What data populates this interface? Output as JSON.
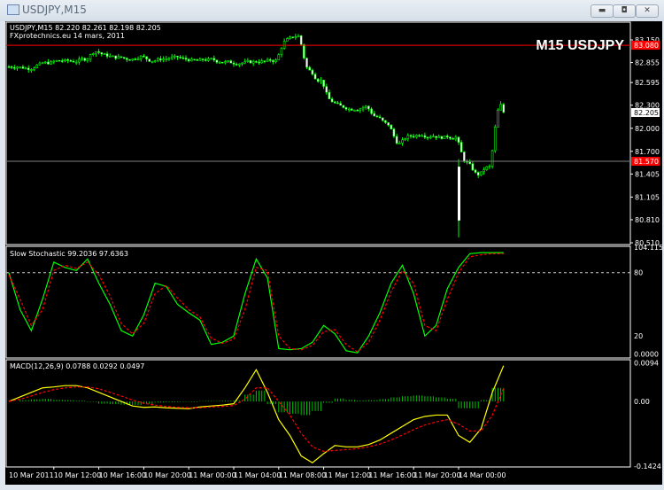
{
  "window": {
    "title": "USDJPY,M15",
    "buttons": [
      "minimize",
      "maximize",
      "close"
    ]
  },
  "main_chart": {
    "header": "USDJPY,M15  82.220 82.261 82.198 82.205",
    "subheader": "FXprotechnics.eu 14 mars, 2011",
    "overlay_title": "M15 USDJPY",
    "price_labels": [
      "83.150",
      "82.855",
      "82.595",
      "82.300",
      "82.000",
      "81.700",
      "81.405",
      "81.105",
      "80.810",
      "80.510"
    ],
    "marker_labels": [
      {
        "text": "83.080",
        "color": "#ff0000"
      },
      {
        "text": "82.205",
        "color": "#ffffff"
      },
      {
        "text": "81.570",
        "color": "#ff0000"
      }
    ],
    "hlines": [
      {
        "value": 83.08,
        "color": "#ff0000"
      },
      {
        "value": 81.57,
        "color": "#808080"
      }
    ]
  },
  "stochastic": {
    "header": "Slow Stochastic 99.2036 97.6363",
    "labels": [
      "104.1155",
      "80",
      "20",
      "0.0000"
    ]
  },
  "macd": {
    "header": "MACD(12,26,9) 0.0788 0.0292 0.0497",
    "labels": [
      "0.0094",
      "0.00",
      "-0.1424"
    ]
  },
  "time_axis": [
    "10 Mar 2011",
    "10 Mar 12:00",
    "10 Mar 16:00",
    "10 Mar 20:00",
    "11 Mar 00:00",
    "11 Mar 04:00",
    "11 Mar 08:00",
    "11 Mar 12:00",
    "11 Mar 16:00",
    "11 Mar 20:00",
    "14 Mar 00:00"
  ],
  "chart_data": [
    {
      "type": "candlestick",
      "title": "USDJPY,M15",
      "ylim": [
        80.51,
        83.15
      ],
      "sampling": "hourly closes",
      "candle_color": "#00ff00",
      "x": [
        "10 Mar 08:00",
        "09:00",
        "10:00",
        "11:00",
        "12:00",
        "13:00",
        "14:00",
        "15:00",
        "16:00",
        "17:00",
        "18:00",
        "19:00",
        "20:00",
        "21:00",
        "22:00",
        "23:00",
        "11 Mar 00:00",
        "01:00",
        "02:00",
        "03:00",
        "04:00",
        "05:00",
        "06:00",
        "07:00",
        "08:00",
        "09:00",
        "10:00",
        "11:00",
        "12:00",
        "13:00",
        "14:00",
        "15:00",
        "16:00",
        "17:00",
        "18:00",
        "19:00",
        "20:00",
        "21:00",
        "22:00",
        "23:00",
        "14 Mar 00:00",
        "01:00",
        "02:00",
        "03:00",
        "04:00"
      ],
      "close": [
        82.8,
        82.78,
        82.83,
        82.85,
        82.88,
        82.87,
        82.9,
        83.0,
        82.95,
        82.92,
        82.9,
        82.93,
        82.88,
        82.9,
        82.92,
        82.9,
        82.88,
        82.89,
        82.87,
        82.86,
        82.85,
        82.86,
        82.87,
        82.88,
        83.15,
        83.2,
        82.75,
        82.62,
        82.35,
        82.28,
        82.25,
        82.28,
        82.15,
        82.05,
        81.8,
        81.9,
        81.92,
        81.9,
        81.88,
        81.88,
        81.55,
        81.4,
        81.5,
        82.3,
        82.21
      ]
    },
    {
      "type": "line",
      "title": "Slow Stochastic",
      "ylim": [
        0,
        104.1155
      ],
      "levels": [
        80,
        20
      ],
      "series": [
        {
          "color": "#00ff00",
          "values": [
            80,
            45,
            25,
            55,
            90,
            85,
            82,
            93,
            70,
            50,
            25,
            20,
            40,
            70,
            67,
            50,
            42,
            35,
            12,
            14,
            20,
            60,
            93,
            75,
            8,
            7,
            8,
            14,
            30,
            22,
            6,
            4,
            20,
            42,
            70,
            87,
            60,
            20,
            30,
            65,
            85,
            98,
            99,
            99,
            99
          ]
        },
        {
          "color": "#ff0000",
          "values": [
            78,
            55,
            30,
            45,
            82,
            87,
            84,
            90,
            78,
            58,
            32,
            22,
            32,
            60,
            68,
            56,
            45,
            38,
            18,
            13,
            17,
            45,
            85,
            82,
            20,
            8,
            7,
            11,
            24,
            26,
            12,
            5,
            14,
            35,
            62,
            82,
            70,
            30,
            25,
            55,
            80,
            95,
            97,
            98,
            98
          ]
        }
      ]
    },
    {
      "type": "line",
      "title": "MACD",
      "ylim": [
        -0.1424,
        0.09
      ],
      "series": [
        {
          "name": "main",
          "color": "#ffff00",
          "values": [
            0,
            0.01,
            0.02,
            0.03,
            0.032,
            0.035,
            0.035,
            0.03,
            0.02,
            0.01,
            0.0,
            -0.01,
            -0.013,
            -0.012,
            -0.014,
            -0.015,
            -0.016,
            -0.012,
            -0.01,
            -0.008,
            -0.005,
            0.03,
            0.07,
            0.02,
            -0.04,
            -0.075,
            -0.12,
            -0.135,
            -0.115,
            -0.097,
            -0.1,
            -0.1,
            -0.095,
            -0.085,
            -0.07,
            -0.055,
            -0.04,
            -0.033,
            -0.03,
            -0.03,
            -0.075,
            -0.09,
            -0.06,
            0.02,
            0.0788
          ]
        },
        {
          "name": "signal",
          "color": "#ff0000",
          "values": [
            0,
            0.005,
            0.012,
            0.02,
            0.026,
            0.03,
            0.032,
            0.032,
            0.028,
            0.02,
            0.012,
            0.003,
            -0.004,
            -0.008,
            -0.011,
            -0.013,
            -0.014,
            -0.014,
            -0.012,
            -0.011,
            -0.009,
            0.005,
            0.03,
            0.03,
            0.0,
            -0.03,
            -0.07,
            -0.1,
            -0.11,
            -0.108,
            -0.106,
            -0.104,
            -0.1,
            -0.094,
            -0.085,
            -0.074,
            -0.062,
            -0.052,
            -0.045,
            -0.04,
            -0.05,
            -0.065,
            -0.065,
            -0.03,
            0.0292
          ]
        }
      ]
    }
  ]
}
